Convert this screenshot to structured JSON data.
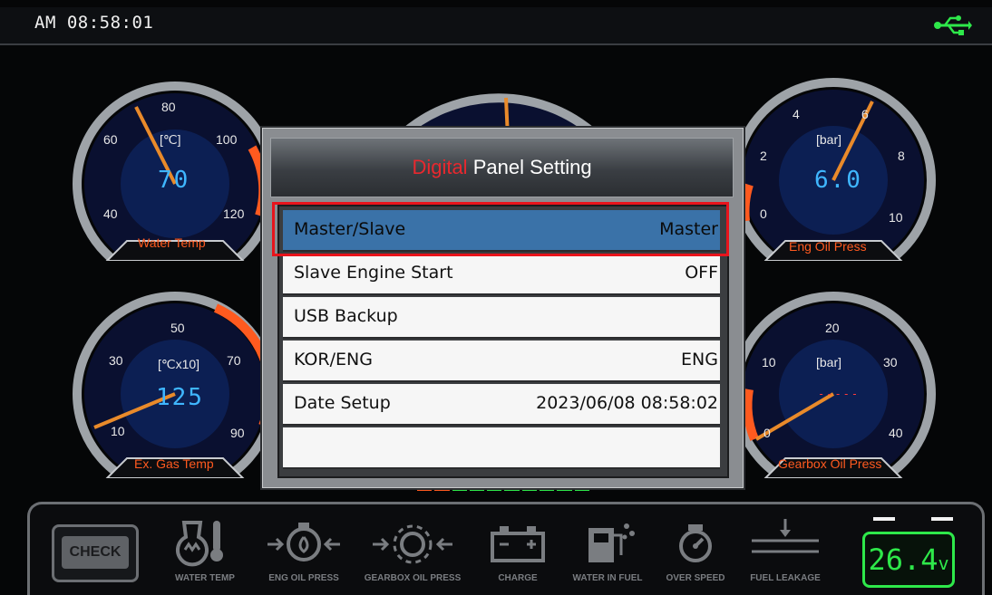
{
  "status_bar": {
    "clock": "AM 08:58:01",
    "usb_icon": "usb-icon",
    "usb_color": "#2ee84a"
  },
  "gauges": {
    "water_temp": {
      "unit": "[℃]",
      "value": "70",
      "ticks": [
        "40",
        "60",
        "80",
        "100",
        "120"
      ],
      "name": "Water Temp",
      "needle_value": 70
    },
    "eng_oil_press": {
      "unit": "[bar]",
      "value": "6.0",
      "ticks": [
        "2",
        "4",
        "6",
        "8",
        "10",
        "0"
      ],
      "name": "Eng Oil Press",
      "needle_value": 6.0
    },
    "ex_gas_temp": {
      "unit": "[℃x10]",
      "value": "125",
      "ticks": [
        "10",
        "30",
        "50",
        "70",
        "90"
      ],
      "name": "Ex. Gas Temp"
    },
    "gearbox_oil_press": {
      "unit": "[bar]",
      "value": "-----",
      "ticks": [
        "0",
        "10",
        "20",
        "30",
        "40"
      ],
      "name": "Gearbox Oil Press"
    }
  },
  "dialog": {
    "title_accent": "Digital",
    "title_rest": " Panel Setting",
    "items": [
      {
        "label": "Master/Slave",
        "value": "Master",
        "selected": true
      },
      {
        "label": "Slave Engine Start",
        "value": "OFF",
        "selected": false
      },
      {
        "label": "USB Backup",
        "value": "",
        "selected": false
      },
      {
        "label": "KOR/ENG",
        "value": "ENG",
        "selected": false
      },
      {
        "label": "Date Setup",
        "value": "2023/06/08 08:58:02",
        "selected": false
      },
      {
        "label": "",
        "value": "",
        "selected": false
      }
    ]
  },
  "indicators": {
    "check": "CHECK",
    "water_temp": "WATER TEMP",
    "eng_oil_press": "ENG OIL PRESS",
    "gearbox_oil_press": "GEARBOX OIL PRESS",
    "charge": "CHARGE",
    "water_in_fuel": "WATER IN FUEL",
    "over_speed": "OVER SPEED",
    "fuel_leakage": "FUEL LEAKAGE"
  },
  "voltage": {
    "value": "26.4",
    "unit": "v"
  },
  "colors": {
    "accent_red": "#e8282e",
    "gauge_blue": "#3fb6ff",
    "label_orange": "#ff5a1f",
    "voltage_green": "#2ee84a",
    "selection_blue": "#3a72a8"
  }
}
